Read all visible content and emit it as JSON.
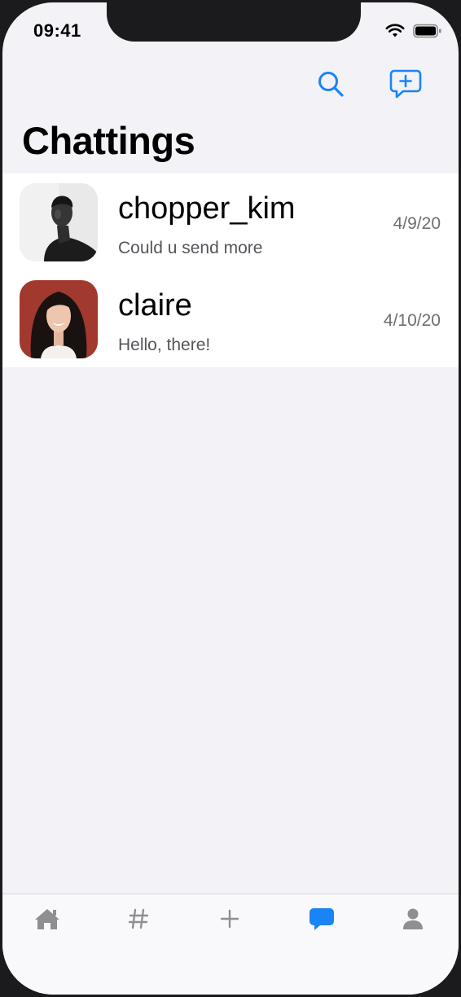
{
  "status": {
    "time": "09:41"
  },
  "nav": {
    "title": "Chattings",
    "search_icon": "search-icon",
    "compose_icon": "compose-message-icon",
    "accent": "#1a84f5"
  },
  "chats": [
    {
      "name": "chopper_kim",
      "preview": "Could u send more",
      "date": "4/9/20",
      "avatar": "avatar-photo-man"
    },
    {
      "name": "claire",
      "preview": "Hello, there!",
      "date": "4/10/20",
      "avatar": "avatar-photo-woman"
    }
  ],
  "tabs": [
    {
      "icon": "home-icon",
      "active": false
    },
    {
      "icon": "hashtag-icon",
      "active": false
    },
    {
      "icon": "plus-icon",
      "active": false
    },
    {
      "icon": "chat-bubble-icon",
      "active": true
    },
    {
      "icon": "person-icon",
      "active": false
    }
  ],
  "colors": {
    "tab_inactive": "#8e8e93",
    "tab_active": "#1a84f5"
  }
}
